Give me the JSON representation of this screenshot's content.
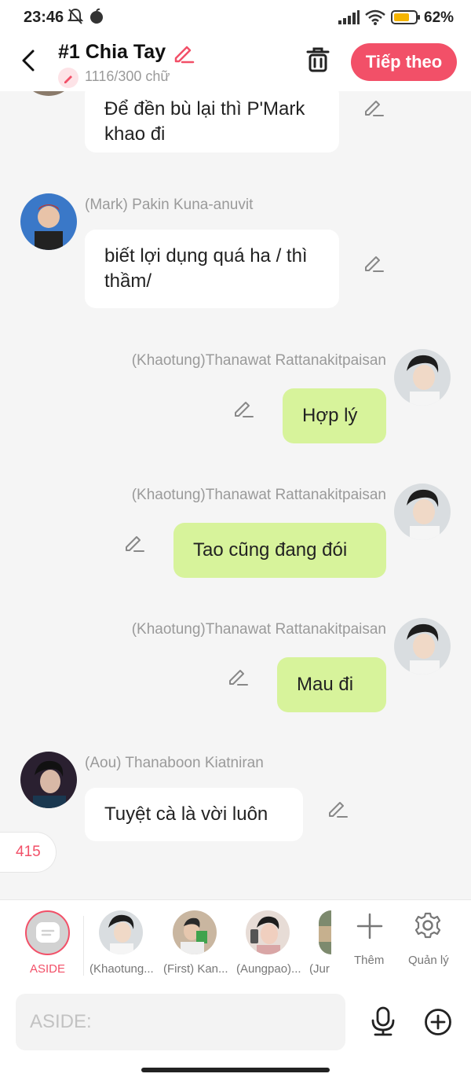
{
  "status_bar": {
    "time": "23:46",
    "battery": "62%"
  },
  "header": {
    "title": "#1 Chia Tay",
    "word_count": "1116/300 chữ",
    "next_label": "Tiếp theo"
  },
  "messages": [
    {
      "text": "Để đền bù lại thì P'Mark khao đi"
    },
    {
      "sender": "(Mark) Pakin Kuna-anuvit",
      "text": "biết lợi dụng quá ha / thì thầm/"
    },
    {
      "sender": "(Khaotung)Thanawat Rattanakitpaisan",
      "text": "Hợp lý"
    },
    {
      "sender": "(Khaotung)Thanawat Rattanakitpaisan",
      "text": "Tao cũng đang đói"
    },
    {
      "sender": "(Khaotung)Thanawat Rattanakitpaisan",
      "text": "Mau đi"
    },
    {
      "sender": "(Aou) Thanaboon Kiatniran",
      "text": "Tuyệt cà là vời luôn"
    }
  ],
  "count_badge": "415",
  "characters": {
    "aside": "ASIDE",
    "items": [
      "(Khaotung...",
      "(First) Kan...",
      "(Aungpao)...",
      "(Jur"
    ],
    "more_label": "Thêm",
    "manage_label": "Quản lý"
  },
  "input": {
    "placeholder": "ASIDE:"
  },
  "colors": {
    "accent": "#f25068",
    "bubble_green": "#d7f39b",
    "bubble_white": "#ffffff",
    "background": "#f5f5f5"
  },
  "icons": [
    "back-arrow-icon",
    "pencil-icon",
    "trash-icon",
    "gear-icon",
    "microphone-icon",
    "plus-circle-icon",
    "plus-icon",
    "chat-icon"
  ]
}
